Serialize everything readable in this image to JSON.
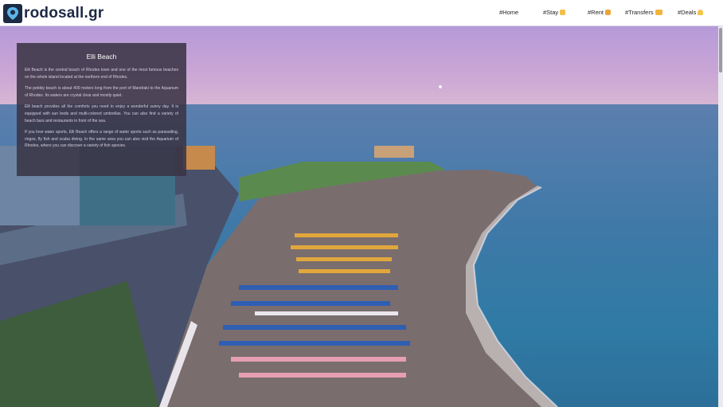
{
  "brand": {
    "name": "rodosall.gr"
  },
  "nav": [
    {
      "label": "#Home",
      "icon": ""
    },
    {
      "label": "#Stay",
      "icon": "hand-icon"
    },
    {
      "label": "#Rent",
      "icon": "car-icon"
    },
    {
      "label": "#Transfers",
      "icon": "bus-icon"
    },
    {
      "label": "#Deals",
      "icon": "bell-icon"
    }
  ],
  "panel": {
    "title": "Elli Beach",
    "paragraphs": [
      "Elli Beach is the central beach of Rhodes town and one of the most famous beaches on the whole island located at the northern end of Rhodes.",
      "The pebbly beach is about 400 meters long from the port of Mandraki to the Aquarium of Rhodes. Its waters are crystal clear and mostly quiet.",
      "Elli beach provides all the comforts you need to enjoy a wonderful sunny day. It is equipped with sun beds and multi-colored umbrellas. You can also find a variety of beach bars and restaurants in front of the sea.",
      "If you love water sports, Elli Beach offers a range of water sports such as parasailing, ringos, fly fish and scuba diving. In the same area you can also visit the Aquarium of Rhodes, where you can discover a variety of fish species."
    ]
  },
  "colors": {
    "brand": "#1d2a44",
    "panel_bg": "#3a3446"
  }
}
